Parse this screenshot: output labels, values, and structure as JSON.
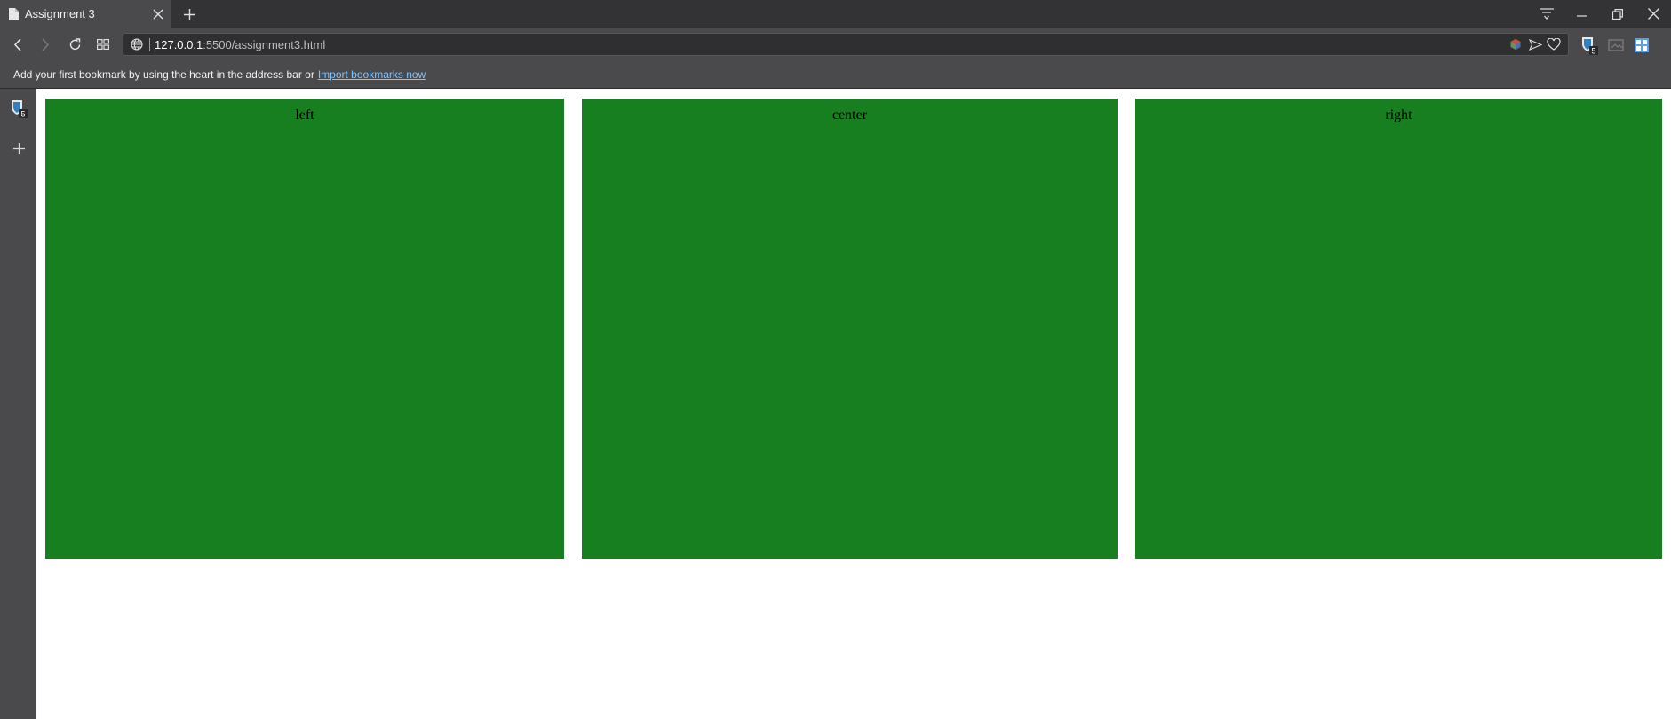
{
  "browser": {
    "tab": {
      "title": "Assignment 3"
    },
    "address": {
      "host": "127.0.0.1",
      "path": ":5500/assignment3.html"
    },
    "bookmarks_bar": {
      "message": "Add your first bookmark by using the heart in the address bar or",
      "import_link": "Import bookmarks now"
    },
    "extension_badge": "5"
  },
  "page": {
    "boxes": [
      {
        "label": "left"
      },
      {
        "label": "center"
      },
      {
        "label": "right"
      }
    ],
    "box_color": "#177f1f"
  },
  "icons": {
    "tab": [
      "document-icon",
      "close-icon",
      "plus-icon"
    ],
    "window": [
      "tab-list-icon",
      "minimize-icon",
      "restore-icon",
      "close-window-icon"
    ],
    "nav": [
      "back-icon",
      "forward-icon",
      "reload-icon",
      "speed-dial-icon",
      "globe-icon"
    ],
    "address_right": [
      "cube-icon",
      "send-icon",
      "heart-icon"
    ],
    "extensions": [
      "shield-icon",
      "screenshot-icon",
      "grid-icon"
    ],
    "side": [
      "shield-icon",
      "plus-icon"
    ]
  }
}
